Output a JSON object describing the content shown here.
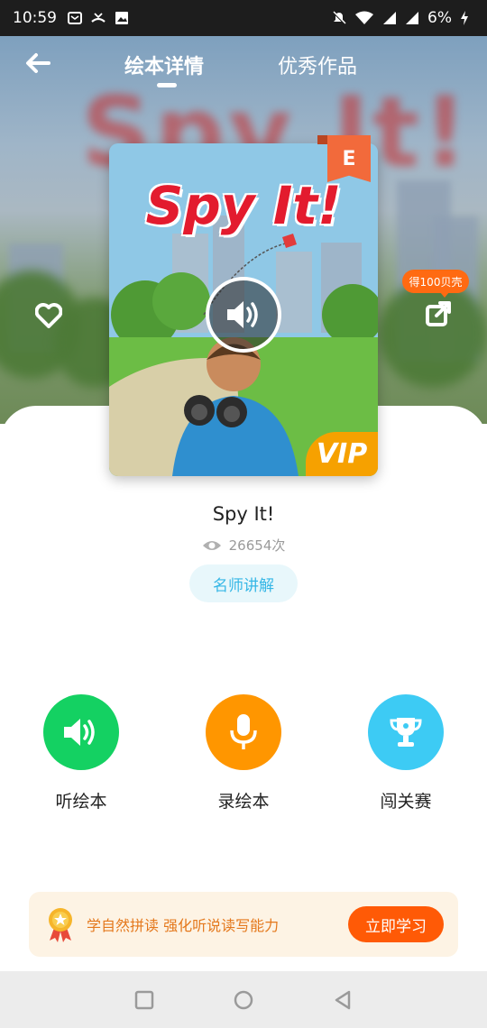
{
  "status_bar": {
    "time": "10:59",
    "battery": "6%"
  },
  "header": {
    "tabs": [
      {
        "label": "绘本详情"
      },
      {
        "label": "优秀作品"
      }
    ]
  },
  "book": {
    "cover_title": "Spy It!",
    "level": "E",
    "vip_label": "VIP",
    "title": "Spy It!",
    "views": "26654次",
    "teacher_label": "名师讲解"
  },
  "share": {
    "reward_label": "得100贝壳"
  },
  "actions": [
    {
      "label": "听绘本",
      "icon": "speaker-icon",
      "color": "#14d162"
    },
    {
      "label": "录绘本",
      "icon": "microphone-icon",
      "color": "#ff9600"
    },
    {
      "label": "闯关赛",
      "icon": "trophy-icon",
      "color": "#3dcbf4"
    }
  ],
  "promo": {
    "text": "学自然拼读 强化听说读写能力",
    "button_label": "立即学习"
  },
  "colors": {
    "accent": "#ff5a06",
    "vip": "#f6a100",
    "badge": "#f26a3b",
    "teacher_text": "#36b7e6"
  }
}
